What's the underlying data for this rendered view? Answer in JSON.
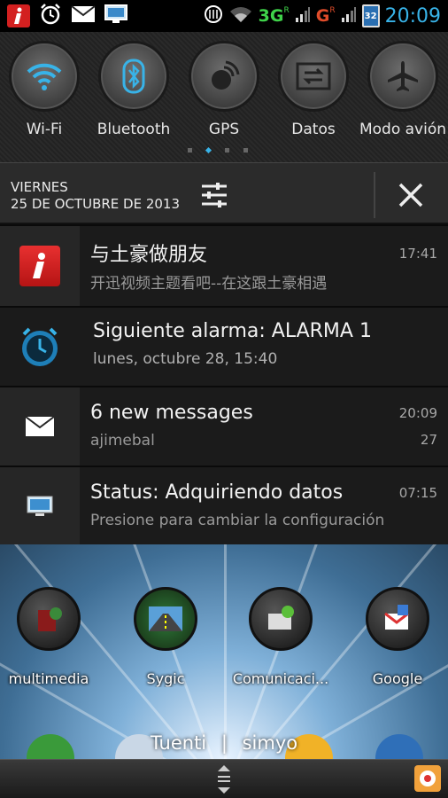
{
  "status_bar": {
    "network_1": "3G",
    "network_1_marker": "R",
    "network_2": "G",
    "network_2_marker": "R",
    "battery_level": "32",
    "time": "20:09",
    "icons": [
      "info-app-icon",
      "alarm-clock-icon",
      "email-icon",
      "monitor-icon",
      "sync-icon",
      "wifi-icon",
      "signal-icon",
      "battery-icon"
    ]
  },
  "quick_settings": {
    "toggles": [
      {
        "label": "Wi-Fi",
        "icon": "wifi-icon"
      },
      {
        "label": "Bluetooth",
        "icon": "bluetooth-icon"
      },
      {
        "label": "GPS",
        "icon": "gps-icon"
      },
      {
        "label": "Datos",
        "icon": "data-transfer-icon"
      },
      {
        "label": "Modo avión",
        "icon": "airplane-icon"
      }
    ],
    "active_page": 2,
    "page_count": 4
  },
  "date_bar": {
    "day": "VIERNES",
    "date": "25 DE OCTUBRE DE 2013"
  },
  "notifications": [
    {
      "title": "与土豪做朋友",
      "subtitle": "开迅视频主题看吧--在这跟土豪相遇",
      "time": "17:41",
      "icon": "info-app-icon"
    },
    {
      "title": "Siguiente alarma: ALARMA 1",
      "subtitle": "lunes, octubre 28, 15:40",
      "time": "",
      "icon": "alarm-clock-icon"
    },
    {
      "title": "6 new messages",
      "subtitle": "ajimebal",
      "time": "20:09",
      "count": "27",
      "icon": "email-icon"
    },
    {
      "title": "Status: Adquiriendo datos",
      "subtitle": "Presione para cambiar la configuración",
      "time": "07:15",
      "icon": "monitor-icon"
    }
  ],
  "home_screen": {
    "apps": [
      {
        "label": "multimedia"
      },
      {
        "label": "Sygic"
      },
      {
        "label": "Comunicaci..."
      },
      {
        "label": "Google"
      }
    ],
    "carrier_1": "Tuenti",
    "carrier_separator": "|",
    "carrier_2": "simyo"
  },
  "colors": {
    "accent": "#38b3e8",
    "network_green": "#3fd34a",
    "notification_bg": "#1b1b1b",
    "toggle_active": "#38b3e8"
  }
}
